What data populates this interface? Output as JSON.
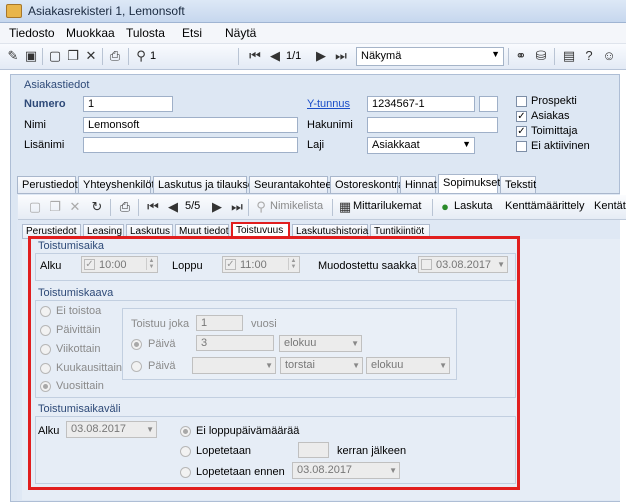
{
  "window": {
    "title": "Asiakasrekisteri 1, Lemonsoft"
  },
  "menu": [
    "Tiedosto",
    "Muokkaa",
    "Tulosta",
    "Etsi",
    "Näytä"
  ],
  "toolbar": {
    "record_no": "1",
    "page": "1/1",
    "view": "Näkymä"
  },
  "customer": {
    "section_title": "Asiakastiedot",
    "numero_label": "Numero",
    "numero_value": "1",
    "nimi_label": "Nimi",
    "nimi_value": "Lemonsoft",
    "lisanimi_label": "Lisänimi",
    "lisanimi_value": "",
    "ytunnus_label": "Y-tunnus",
    "ytunnus_value": "1234567-1",
    "hakunimi_label": "Hakunimi",
    "hakunimi_value": "",
    "laji_label": "Laji",
    "laji_value": "Asiakkaat",
    "checks": [
      {
        "label": "Prospekti",
        "checked": false
      },
      {
        "label": "Asiakas",
        "checked": true
      },
      {
        "label": "Toimittaja",
        "checked": true
      },
      {
        "label": "Ei aktiivinen",
        "checked": false
      }
    ]
  },
  "main_tabs": [
    "Perustiedot",
    "Yhteyshenkilöt",
    "Laskutus ja tilaukset",
    "Seurantakohteet",
    "Ostoreskontra",
    "Hinnat",
    "Sopimukset",
    "Tekstit"
  ],
  "main_tab_active": "Sopimukset",
  "sub_toolbar": {
    "page": "5/5",
    "search_label": "Nimikelista",
    "meter_label": "Mittarilukemat",
    "invoice_label": "Laskuta",
    "rates_label": "Kenttämäärittely",
    "fields_label": "Kentät"
  },
  "sub_tabs": [
    "Perustiedot",
    "Leasing",
    "Laskutus",
    "Muut tiedot",
    "Toistuvuus",
    "Laskutushistoria",
    "Tuntikiintiöt"
  ],
  "sub_tab_active": "Toistuvuus",
  "recurrence_time": {
    "title": "Toistumisaika",
    "start_label": "Alku",
    "start_value": "10:00",
    "end_label": "Loppu",
    "end_value": "11:00",
    "modified_label": "Muodostettu saakka",
    "modified_value": "03.08.2017"
  },
  "recurrence_pattern": {
    "title": "Toistumiskaava",
    "options": [
      "Ei toistoa",
      "Päivittäin",
      "Viikottain",
      "Kuukausittain",
      "Vuosittain"
    ],
    "selected": "Vuosittain",
    "repeat_every_label": "Toistuu joka",
    "repeat_every_value": "1",
    "repeat_every_unit": "vuosi",
    "day_label": "Päivä",
    "day_value": "3",
    "day_month": "elokuu",
    "day2_label": "Päivä",
    "day2_ordinal": "",
    "day2_weekday": "torstai",
    "day2_month": "elokuu"
  },
  "recurrence_range": {
    "title": "Toistumisaikaväli",
    "start_label": "Alku",
    "start_value": "03.08.2017",
    "no_end_label": "Ei loppupäivämäärää",
    "end_after_label": "Lopetetaan",
    "end_after_value": "",
    "end_after_suffix": "kerran jälkeen",
    "end_by_label": "Lopetetaan ennen",
    "end_by_value": "03.08.2017"
  }
}
